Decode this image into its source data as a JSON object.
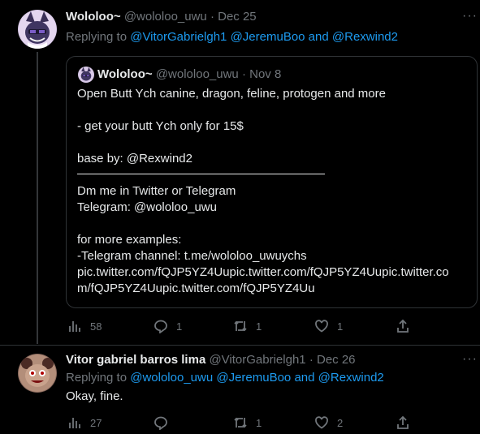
{
  "tweets": [
    {
      "name": "Wololoo~",
      "handle": "@wololoo_uwu",
      "separator": "·",
      "date": "Dec 25",
      "replying_prefix": "Replying to ",
      "replying_to": [
        "@VitorGabrielgh1",
        "@JeremuBoo",
        "@Rexwind2"
      ],
      "replying_joiner": " and ",
      "more_icon": "more-dots-icon",
      "quote": {
        "name": "Wololoo~",
        "handle": "@wololoo_uwu",
        "separator": "·",
        "date": "Nov 8",
        "lines": [
          "Open Butt Ych canine, dragon, feline, protogen and more",
          "",
          "- get your butt Ych only for 15$",
          "",
          "base by: @Rexwind2",
          "",
          "Dm me in Twitter or Telegram",
          "Telegram: @wololoo_uwu",
          "",
          "for more examples:",
          "-Telegram channel: t.me/wololoo_uwuychs",
          "pic.twitter.com/fQJP5YZ4Uupic.twitter.com/fQJP5YZ4Uupic.twitter.co",
          "m/fQJP5YZ4Uupic.twitter.com/fQJP5YZ4Uu"
        ]
      },
      "actions": {
        "views": "58",
        "replies": "1",
        "retweets": "1",
        "likes": "1"
      }
    },
    {
      "name": "Vitor gabriel barros lima",
      "handle": "@VitorGabrielgh1",
      "separator": "·",
      "date": "Dec 26",
      "replying_prefix": "Replying to ",
      "replying_to": [
        "@wololoo_uwu",
        "@JeremuBoo",
        "@Rexwind2"
      ],
      "replying_joiner": " and ",
      "text": "Okay, fine.",
      "more_icon": "more-dots-icon",
      "actions": {
        "views": "27",
        "replies": "",
        "retweets": "1",
        "likes": "2"
      }
    }
  ],
  "colors": {
    "background": "#000000",
    "text": "#e7e9ea",
    "muted": "#71767b",
    "link": "#1d9bf0",
    "border": "#2f3336"
  }
}
